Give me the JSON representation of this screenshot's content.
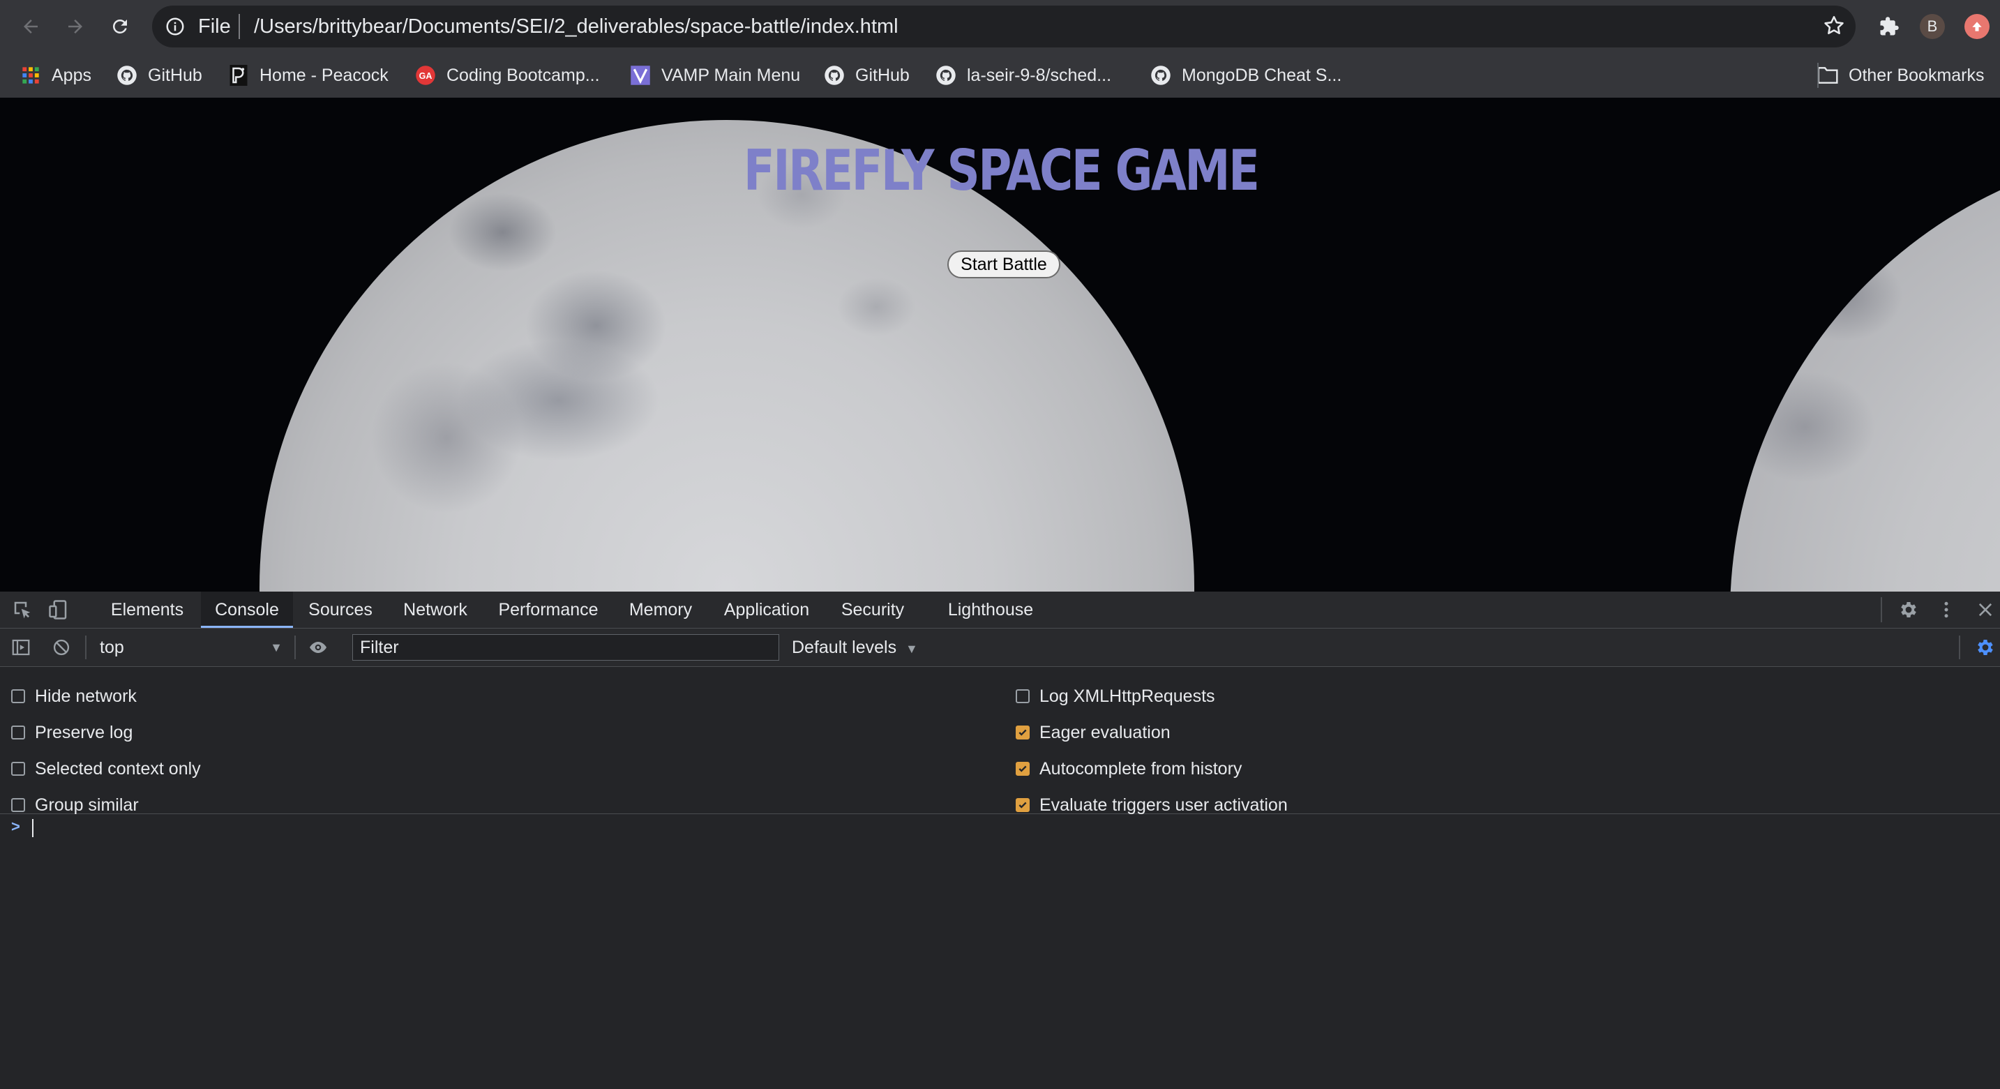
{
  "browser": {
    "address_scheme": "File",
    "address_url": "/Users/brittybear/Documents/SEI/2_deliverables/space-battle/index.html",
    "profile_initial": "B",
    "icons": [
      "back-icon",
      "forward-icon",
      "reload-icon",
      "info-icon",
      "star-icon",
      "extensions-icon"
    ]
  },
  "bookmarks": {
    "items": [
      {
        "label": "Apps",
        "icon": "apps-grid-icon"
      },
      {
        "label": "GitHub",
        "icon": "github-icon"
      },
      {
        "label": "Home - Peacock",
        "icon": "peacock-icon"
      },
      {
        "label": "Coding Bootcamp...",
        "icon": "ga-icon"
      },
      {
        "label": "VAMP Main Menu",
        "icon": "vamp-icon"
      },
      {
        "label": "GitHub",
        "icon": "github-icon"
      },
      {
        "label": "la-seir-9-8/sched...",
        "icon": "github-icon"
      },
      {
        "label": "MongoDB Cheat S...",
        "icon": "github-icon"
      }
    ],
    "other": "Other Bookmarks"
  },
  "page": {
    "title": "FIREFLY SPACE GAME",
    "start_button": "Start Battle"
  },
  "devtools": {
    "tabs": [
      "Elements",
      "Console",
      "Sources",
      "Network",
      "Performance",
      "Memory",
      "Application",
      "Security",
      "Lighthouse"
    ],
    "active_tab": "Console",
    "context": "top",
    "filter_placeholder": "Filter",
    "levels": "Default levels",
    "settings": {
      "left": [
        {
          "label": "Hide network",
          "checked": false
        },
        {
          "label": "Preserve log",
          "checked": false
        },
        {
          "label": "Selected context only",
          "checked": false
        },
        {
          "label": "Group similar",
          "checked": false
        }
      ],
      "right": [
        {
          "label": "Log XMLHttpRequests",
          "checked": false
        },
        {
          "label": "Eager evaluation",
          "checked": true
        },
        {
          "label": "Autocomplete from history",
          "checked": true
        },
        {
          "label": "Evaluate triggers user activation",
          "checked": true
        }
      ]
    },
    "prompt_symbol": ">"
  },
  "colors": {
    "title": "#7e80c9",
    "toolbar": "#35363a",
    "checkbox_on": "#e0a040",
    "devtools_bg": "#242528"
  }
}
